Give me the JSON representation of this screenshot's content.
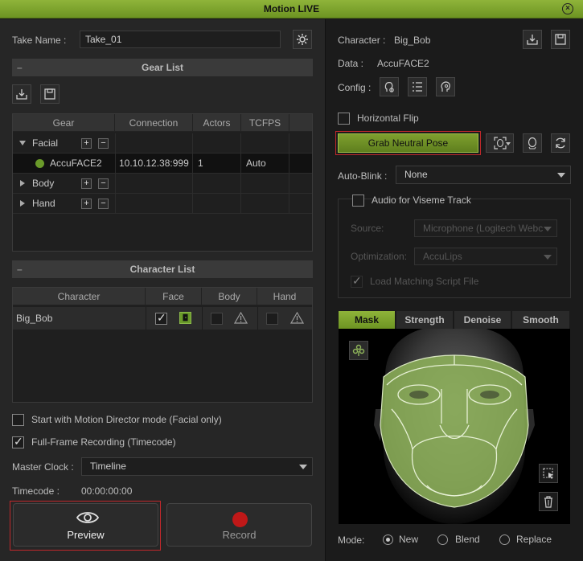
{
  "window": {
    "title": "Motion LIVE"
  },
  "take": {
    "label": "Take Name :",
    "value": "Take_01"
  },
  "gear_list": {
    "title": "Gear List",
    "columns": [
      "Gear",
      "Connection",
      "Actors",
      "TCFPS"
    ],
    "groups": [
      {
        "label": "Facial",
        "expanded": true
      },
      {
        "label": "Body",
        "expanded": false
      },
      {
        "label": "Hand",
        "expanded": false
      }
    ],
    "device": {
      "name": "AccuFACE2",
      "connection": "10.10.12.38:999",
      "actors": "1",
      "tcfps": "Auto"
    }
  },
  "character_list": {
    "title": "Character List",
    "columns": [
      "Character",
      "Face",
      "Body",
      "Hand"
    ],
    "row": {
      "name": "Big_Bob"
    }
  },
  "options": {
    "motion_director": "Start with Motion Director mode (Facial only)",
    "full_frame": "Full-Frame Recording (Timecode)"
  },
  "master_clock": {
    "label": "Master Clock :",
    "value": "Timeline"
  },
  "timecode": {
    "label": "Timecode :",
    "value": "00:00:00:00"
  },
  "buttons": {
    "preview": "Preview",
    "record": "Record",
    "grab_neutral": "Grab Neutral Pose"
  },
  "right": {
    "character_label": "Character :",
    "character_value": "Big_Bob",
    "data_label": "Data :",
    "data_value": "AccuFACE2",
    "config_label": "Config :",
    "horizontal_flip": "Horizontal Flip",
    "auto_blink_label": "Auto-Blink :",
    "auto_blink_value": "None",
    "audio_viseme": "Audio for Viseme Track",
    "source_label": "Source:",
    "source_value": "Microphone (Logitech Webc",
    "optimization_label": "Optimization:",
    "optimization_value": "AccuLips",
    "load_matching": "Load Matching Script File"
  },
  "tabs": [
    "Mask",
    "Strength",
    "Denoise",
    "Smooth"
  ],
  "mode": {
    "label": "Mode:",
    "options": [
      "New",
      "Blend",
      "Replace"
    ],
    "selected": "New"
  },
  "colors": {
    "accent": "#7ea02e",
    "highlight_border": "#c0282b",
    "record": "#c01818",
    "mask": "#8fb45a"
  }
}
